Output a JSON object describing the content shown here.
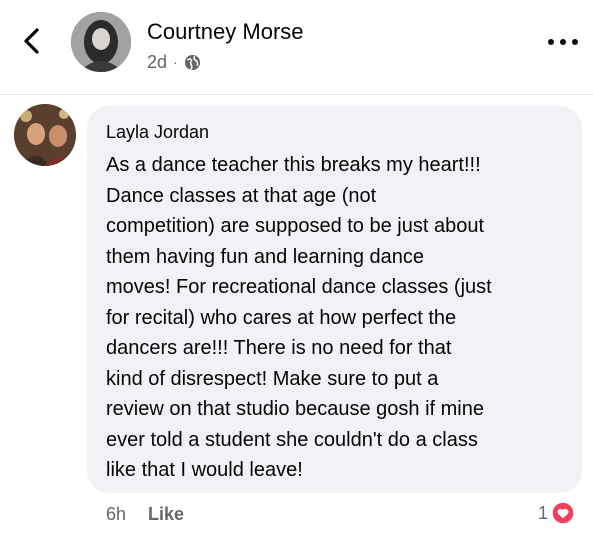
{
  "header": {
    "poster_name": "Courtney Morse",
    "post_age": "2d",
    "separator": "·",
    "privacy_icon": "globe-icon",
    "back_icon": "chevron-left-icon",
    "more_icon": "more-horizontal-icon"
  },
  "comment": {
    "author": "Layla Jordan",
    "text": "As a dance teacher this breaks my heart!!!\nDance  classes at that age (not\ncompetition) are supposed to be just about\nthem having fun and learning dance\nmoves! For recreational dance classes (just\nfor recital) who cares at how perfect the\ndancers are!!! There is no need for that\nkind of disrespect! Make sure to put a\nreview on that studio because gosh if mine\never told a student she couldn't do a class\nlike that I would leave!",
    "time": "6h",
    "like_label": "Like",
    "reaction_count": "1",
    "reaction_icon": "love-reaction-icon"
  },
  "colors": {
    "bubble": "#f0f2f5",
    "secondary_text": "#65676b",
    "love_red": "#f33e58"
  }
}
